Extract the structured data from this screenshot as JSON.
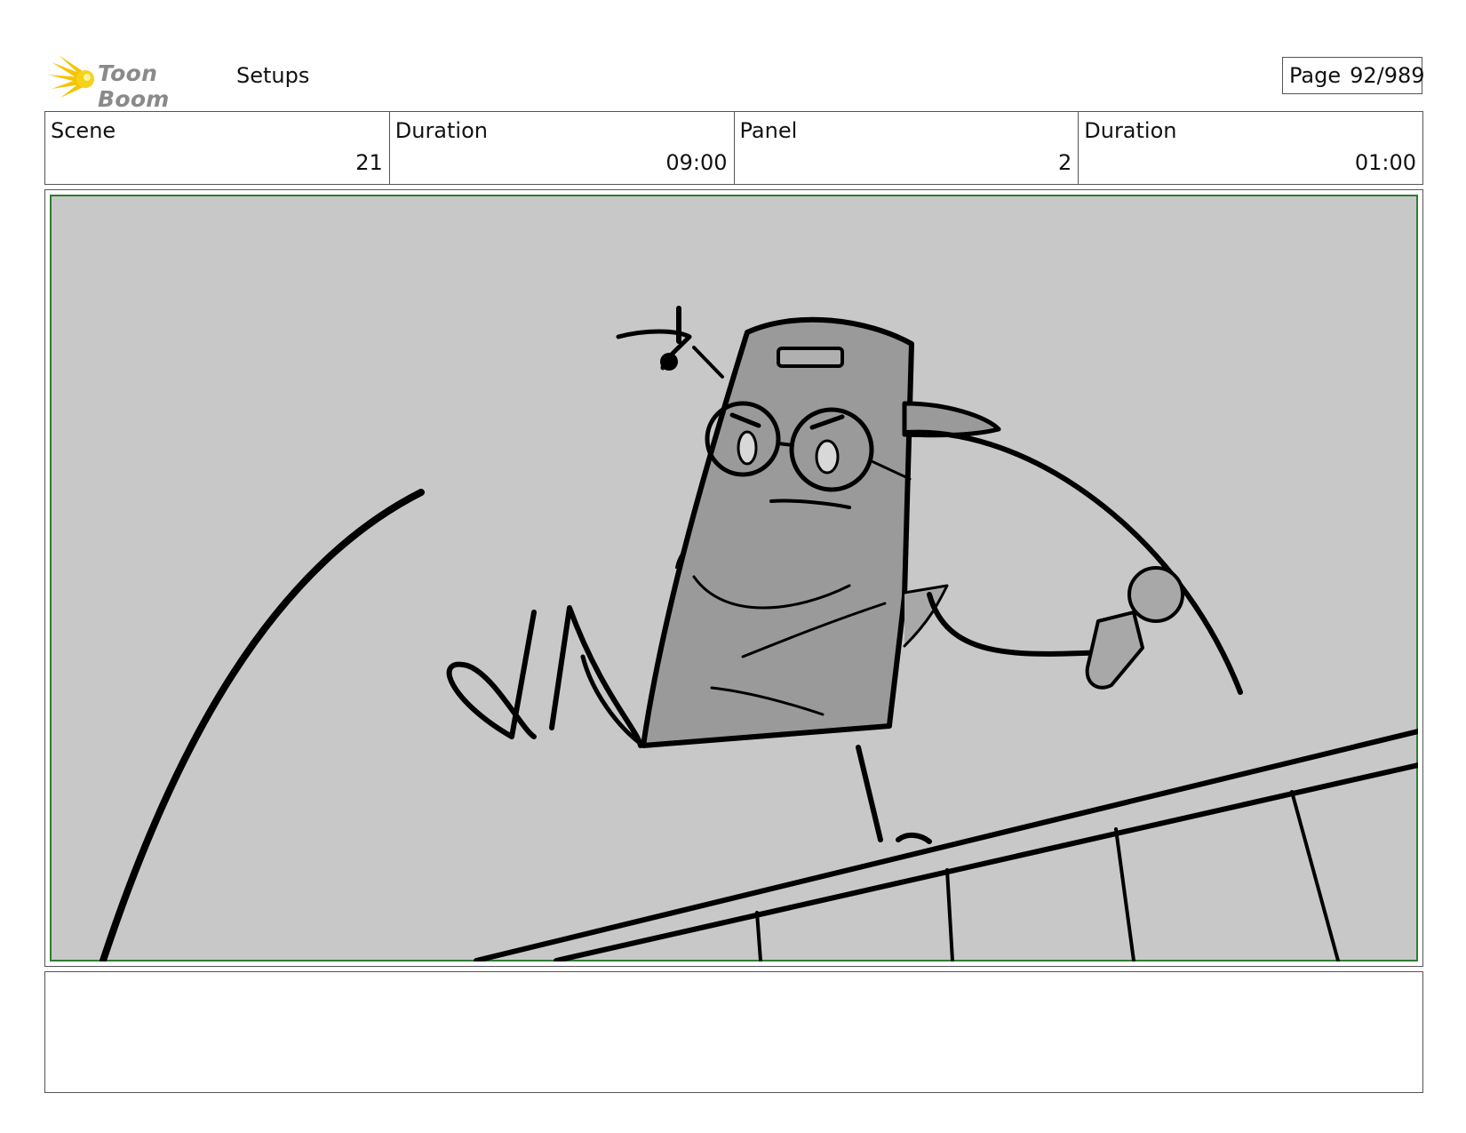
{
  "header": {
    "brand": "Toon Boom",
    "section": "Setups",
    "page_label": "Page",
    "page_number": "92/989"
  },
  "info": {
    "scene_label": "Scene",
    "scene_value": "21",
    "scene_duration_label": "Duration",
    "scene_duration_value": "09:00",
    "panel_label": "Panel",
    "panel_value": "2",
    "panel_duration_label": "Duration",
    "panel_duration_value": "01:00"
  },
  "colors": {
    "panel_bg": "#c8c8c8",
    "panel_border": "#2e7d32",
    "logo_star": "#f5c400"
  }
}
